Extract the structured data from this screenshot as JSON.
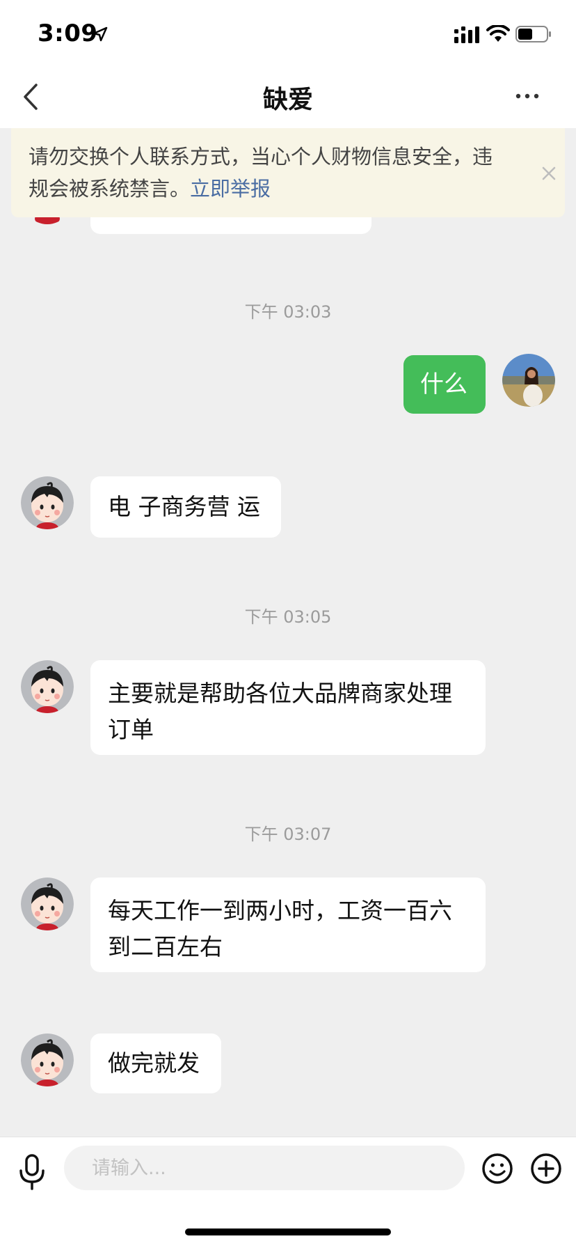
{
  "status_bar": {
    "time": "3:09"
  },
  "nav": {
    "title": "缺爱"
  },
  "banner": {
    "text": "请勿交换个人联系方式，当心个人财物信息安全，违规会被系统禁言。",
    "link": "立即举报"
  },
  "messages": {
    "ts1": "下午 03:03",
    "m1": "什么",
    "m2": "电 子商务营 运",
    "ts2": "下午 03:05",
    "m3": "主要就是帮助各位大品牌商家处理订单",
    "ts3": "下午 03:07",
    "m4": "每天工作一到两小时，工资一百六到二百左右",
    "m5": "做完就发"
  },
  "input_bar": {
    "placeholder": "请输入..."
  },
  "colors": {
    "accent_green": "#44bd59",
    "link_blue": "#4a6da3",
    "banner_bg": "#f8f5e6",
    "chat_bg": "#efefef"
  },
  "icons": [
    "location-arrow-icon",
    "signal-icon",
    "wifi-icon",
    "battery-icon",
    "back-icon",
    "more-icon",
    "close-icon",
    "microphone-icon",
    "emoji-icon",
    "plus-icon"
  ]
}
